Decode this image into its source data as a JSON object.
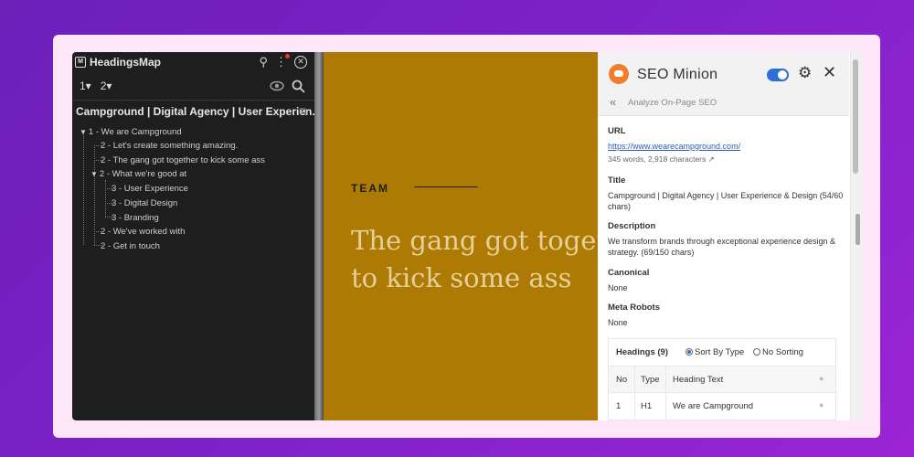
{
  "headingsmap": {
    "title": "HeadingsMap",
    "levels": [
      "1▾",
      "2▾"
    ],
    "doc_title": "Campground | Digital Agency | User Experien...",
    "icons": [
      "pin-icon",
      "menu-dots-icon",
      "close-icon",
      "eye-icon",
      "search-icon",
      "copy-icon"
    ],
    "tree": [
      {
        "text": "1 - We are Campground"
      },
      {
        "text": "2 - Let's create something amazing."
      },
      {
        "text": "2 - The gang got together to kick some ass"
      },
      {
        "text": "2 - What we're good at"
      },
      {
        "text": "3 - User Experience"
      },
      {
        "text": "3 - Digital Design"
      },
      {
        "text": "3 - Branding"
      },
      {
        "text": "2 - We've worked with"
      },
      {
        "text": "2 - Get in touch"
      }
    ]
  },
  "page": {
    "label": "TEAM",
    "headline": "The gang got together to kick some ass",
    "background": "#ad7b03"
  },
  "seo": {
    "title": "SEO Minion",
    "back_label": "Analyze On-Page SEO",
    "url_label": "URL",
    "url": "https://www.wearecampground.com/",
    "url_meta": "345 words, 2,918 characters",
    "title_label": "Title",
    "title_value": "Campground | Digital Agency | User Experience & Design (54/60 chars)",
    "description_label": "Description",
    "description_value": "We transform brands through exceptional experience design & strategy. (69/150 chars)",
    "canonical_label": "Canonical",
    "canonical_value": "None",
    "robots_label": "Meta Robots",
    "robots_value": "None",
    "headings": {
      "count_label": "Headings (9)",
      "sort_type": "Sort By Type",
      "no_sort": "No Sorting",
      "columns": [
        "No",
        "Type",
        "Heading Text"
      ],
      "rows": [
        {
          "no": "1",
          "type": "H1",
          "text": "We are Campground"
        }
      ]
    },
    "accent": "#2d6fd6"
  }
}
